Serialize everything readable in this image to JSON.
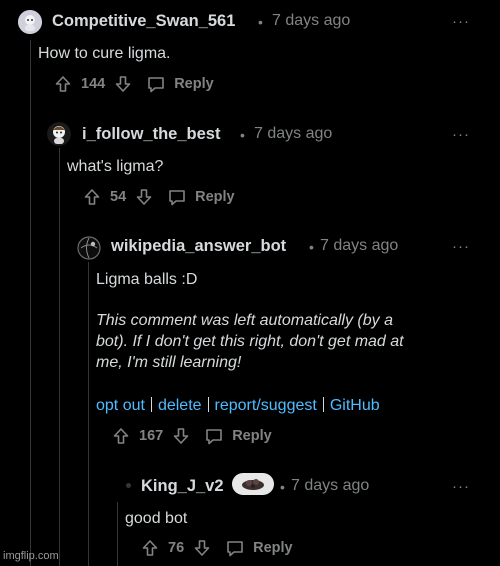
{
  "comments": [
    {
      "username": "Competitive_Swan_561",
      "time": "7 days ago",
      "body": "How to cure ligma.",
      "votes": "144",
      "reply_label": "Reply"
    },
    {
      "username": "i_follow_the_best",
      "time": "7 days ago",
      "body": "what's ligma?",
      "votes": "54",
      "reply_label": "Reply"
    },
    {
      "username": "wikipedia_answer_bot",
      "time": "7 days ago",
      "body": "Ligma balls :D",
      "italic_lines": [
        "This comment was left automatically (by a",
        "bot). If I don't get this right, don't get mad at",
        "me, I'm still learning!"
      ],
      "links": [
        "opt out",
        "delete",
        "report/suggest",
        "GitHub"
      ],
      "votes": "167",
      "reply_label": "Reply"
    },
    {
      "username": "King_J_v2",
      "time": "7 days ago",
      "body": "good bot",
      "votes": "76",
      "reply_label": "Reply"
    }
  ],
  "separator": "•",
  "more_glyph": "···",
  "watermark": "imgflip.com",
  "colors": {
    "background": "#000000",
    "text": "#d7dadc",
    "meta": "#818384",
    "link": "#4fbcff",
    "thread_line": "#343536"
  }
}
